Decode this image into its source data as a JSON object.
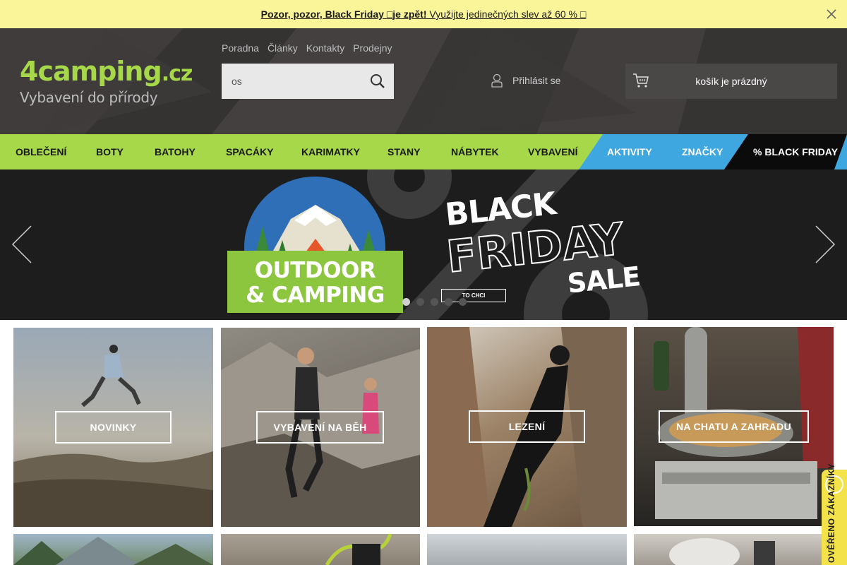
{
  "announcement": {
    "bold_text": "Pozor, pozor, Black Friday ",
    "icon1": "□",
    "bold_text2": "je zpět!",
    "text": " Využijte jedinečných slev až 60 % ",
    "icon2": "□"
  },
  "header": {
    "logo_main": "4camping",
    "logo_tld": ".cz",
    "logo_tagline": "Vybavení do přírody",
    "top_links": [
      "Poradna",
      "Články",
      "Kontakty",
      "Prodejny"
    ],
    "search_value": "os",
    "login_label": "Přihlásit se",
    "cart_label": "košík je prázdný"
  },
  "nav": {
    "items": [
      "OBLEČENÍ",
      "BOTY",
      "BATOHY",
      "SPACÁKY",
      "KARIMATKY",
      "STANY",
      "NÁBYTEK",
      "VYBAVENÍ"
    ],
    "aktivity": "AKTIVITY",
    "znacky": "ZNAČKY",
    "black_friday": "% BLACK FRIDAY"
  },
  "hero": {
    "camping_line1": "OUTDOOR",
    "camping_line2": "& CAMPING",
    "bf_line1": "BLACK",
    "bf_line2": "FRIDAY",
    "bf_line3": "SALE",
    "cta": "TO CHCI",
    "slides": 5,
    "active_slide": 1
  },
  "tiles": [
    {
      "label": "NOVINKY"
    },
    {
      "label": "VYBAVENÍ NA BĚH"
    },
    {
      "label": "LEZENÍ"
    },
    {
      "label": "NA CHATU A ZAHRADU"
    }
  ],
  "side_badge": {
    "text": "OVĚŘENO ZÁKAZNÍKY"
  },
  "colors": {
    "announcement_bg": "#fbf599",
    "header_bg": "#3b3838",
    "nav_green": "#a6d84a",
    "nav_blue": "#3fa7e0",
    "nav_black": "#0b0b0b",
    "badge_yellow": "#f3e24a"
  }
}
